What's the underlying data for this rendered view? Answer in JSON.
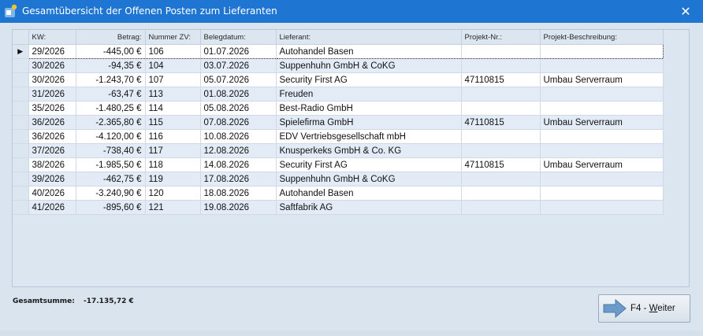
{
  "window": {
    "title": "Gesamtübersicht der Offenen Posten zum Lieferanten",
    "close_symbol": "✕",
    "title_icon": "app-icon"
  },
  "columns": [
    {
      "key": "kw",
      "label": "KW:"
    },
    {
      "key": "betrag",
      "label": "Betrag:"
    },
    {
      "key": "nummer_zv",
      "label": "Nummer ZV:"
    },
    {
      "key": "belegdatum",
      "label": "Belegdatum:"
    },
    {
      "key": "lieferant",
      "label": "Lieferant:"
    },
    {
      "key": "projekt_nr",
      "label": "Projekt-Nr.:"
    },
    {
      "key": "projekt_beschreibung",
      "label": "Projekt-Beschreibung:"
    }
  ],
  "current_row_marker": "▶",
  "rows": [
    {
      "kw": "29/2026",
      "betrag": "-445,00 €",
      "nummer_zv": "106",
      "belegdatum": "01.07.2026",
      "lieferant": "Autohandel Basen",
      "projekt_nr": "",
      "projekt_beschreibung": ""
    },
    {
      "kw": "30/2026",
      "betrag": "-94,35 €",
      "nummer_zv": "104",
      "belegdatum": "03.07.2026",
      "lieferant": "Suppenhuhn GmbH & CoKG",
      "projekt_nr": "",
      "projekt_beschreibung": ""
    },
    {
      "kw": "30/2026",
      "betrag": "-1.243,70 €",
      "nummer_zv": "107",
      "belegdatum": "05.07.2026",
      "lieferant": "Security First AG",
      "projekt_nr": "47110815",
      "projekt_beschreibung": "Umbau Serverraum"
    },
    {
      "kw": "31/2026",
      "betrag": "-63,47 €",
      "nummer_zv": "113",
      "belegdatum": "01.08.2026",
      "lieferant": "Freuden",
      "projekt_nr": "",
      "projekt_beschreibung": ""
    },
    {
      "kw": "35/2026",
      "betrag": "-1.480,25 €",
      "nummer_zv": "114",
      "belegdatum": "05.08.2026",
      "lieferant": "Best-Radio GmbH",
      "projekt_nr": "",
      "projekt_beschreibung": ""
    },
    {
      "kw": "36/2026",
      "betrag": "-2.365,80 €",
      "nummer_zv": "115",
      "belegdatum": "07.08.2026",
      "lieferant": "Spielefirma GmbH",
      "projekt_nr": "47110815",
      "projekt_beschreibung": "Umbau Serverraum"
    },
    {
      "kw": "36/2026",
      "betrag": "-4.120,00 €",
      "nummer_zv": "116",
      "belegdatum": "10.08.2026",
      "lieferant": "EDV Vertriebsgesellschaft mbH",
      "projekt_nr": "",
      "projekt_beschreibung": ""
    },
    {
      "kw": "37/2026",
      "betrag": "-738,40 €",
      "nummer_zv": "117",
      "belegdatum": "12.08.2026",
      "lieferant": "Knusperkeks GmbH & Co. KG",
      "projekt_nr": "",
      "projekt_beschreibung": ""
    },
    {
      "kw": "38/2026",
      "betrag": "-1.985,50 €",
      "nummer_zv": "118",
      "belegdatum": "14.08.2026",
      "lieferant": "Security First AG",
      "projekt_nr": "47110815",
      "projekt_beschreibung": "Umbau Serverraum"
    },
    {
      "kw": "39/2026",
      "betrag": "-462,75 €",
      "nummer_zv": "119",
      "belegdatum": "17.08.2026",
      "lieferant": "Suppenhuhn GmbH & CoKG",
      "projekt_nr": "",
      "projekt_beschreibung": ""
    },
    {
      "kw": "40/2026",
      "betrag": "-3.240,90 €",
      "nummer_zv": "120",
      "belegdatum": "18.08.2026",
      "lieferant": "Autohandel Basen",
      "projekt_nr": "",
      "projekt_beschreibung": ""
    },
    {
      "kw": "41/2026",
      "betrag": "-895,60 €",
      "nummer_zv": "121",
      "belegdatum": "19.08.2026",
      "lieferant": "Saftfabrik AG",
      "projekt_nr": "",
      "projekt_beschreibung": ""
    }
  ],
  "footer": {
    "total_label": "Gesamtsumme:",
    "total_value": "-17.135,72 €"
  },
  "weiter_button": {
    "label_prefix": "F4 - ",
    "label_underlined": "W",
    "label_rest": "eiter",
    "icon": "arrow-right-icon"
  }
}
